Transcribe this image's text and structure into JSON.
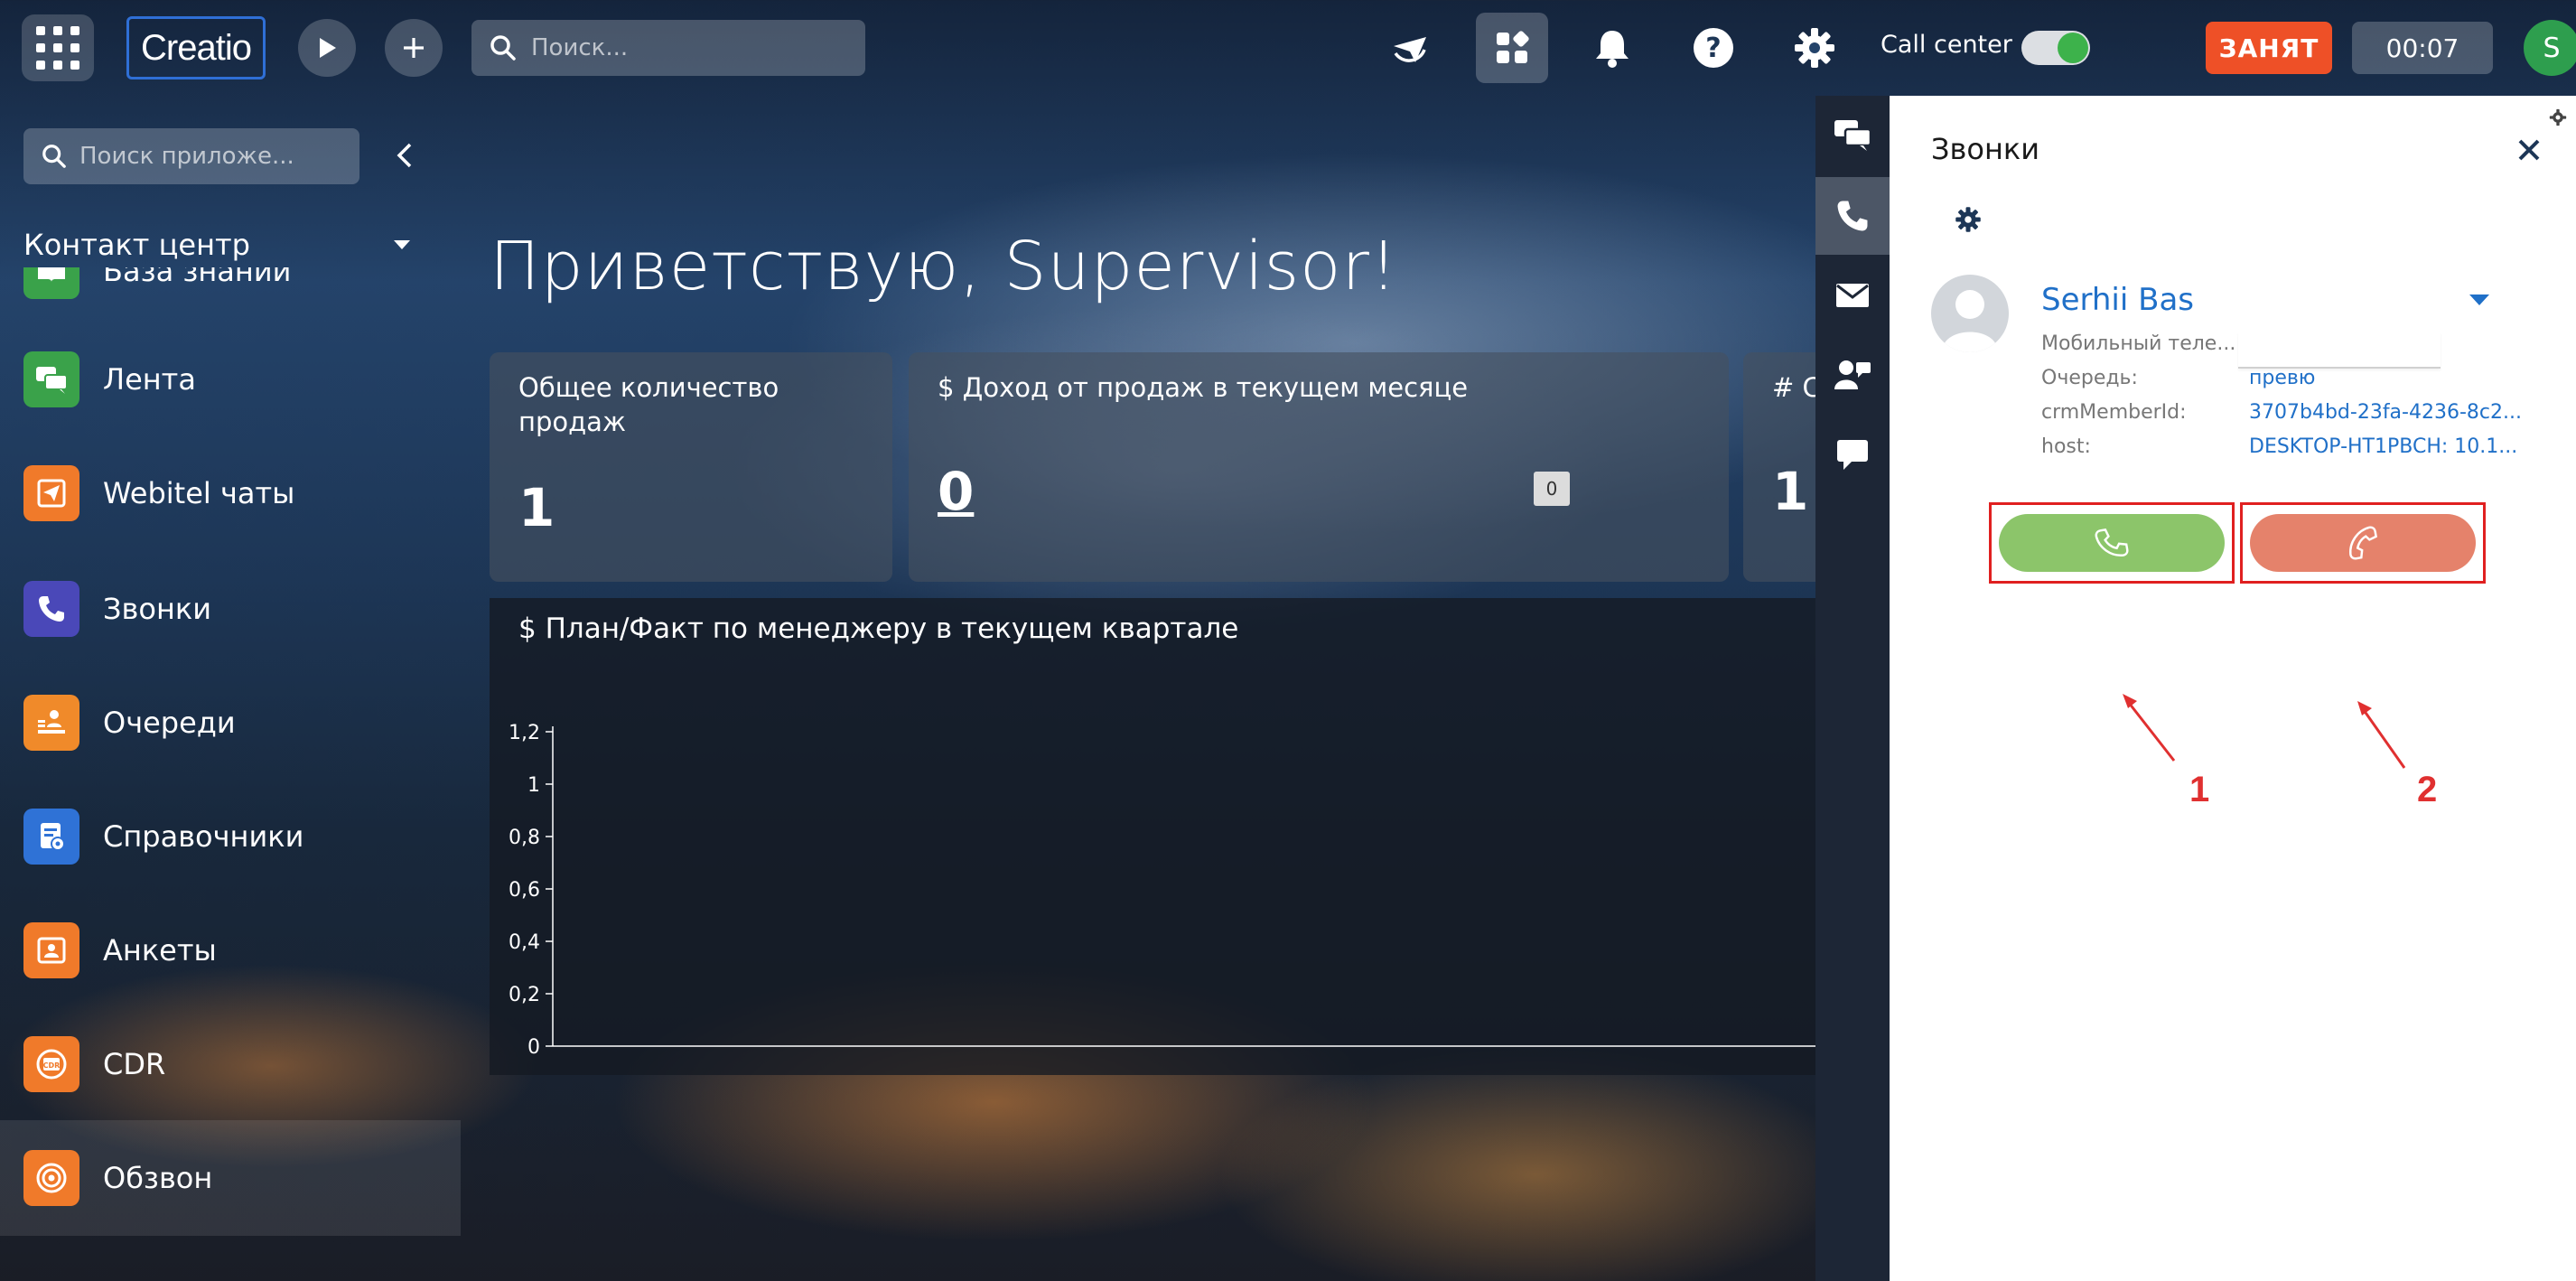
{
  "topbar": {
    "logo_text": "Creatio",
    "search_placeholder": "Поиск...",
    "call_center_label": "Call center",
    "call_center_enabled": true,
    "status_button": "ЗАНЯТ",
    "timer": "00:07",
    "user_initial": "S",
    "icons": [
      "apps-grid-icon",
      "play-icon",
      "plus-icon",
      "search-icon",
      "plane-icon",
      "tiles-icon",
      "bell-icon",
      "help-icon",
      "gear-icon"
    ]
  },
  "sidebar": {
    "search_placeholder": "Поиск приложе...",
    "section_title": "Контакт центр",
    "items": [
      {
        "label": "База знаний",
        "icon": "book-icon",
        "color": "#3aa24a"
      },
      {
        "label": "Лента",
        "icon": "chat-icon",
        "color": "#3aa24a"
      },
      {
        "label": "Webitel чаты",
        "icon": "send-icon",
        "color": "#f07a2a"
      },
      {
        "label": "Звонки",
        "icon": "phone-icon",
        "color": "#4a48b8"
      },
      {
        "label": "Очереди",
        "icon": "queue-icon",
        "color": "#f08a2a"
      },
      {
        "label": "Справочники",
        "icon": "directory-icon",
        "color": "#2f72d6"
      },
      {
        "label": "Анкеты",
        "icon": "form-icon",
        "color": "#f07a2a"
      },
      {
        "label": "CDR",
        "icon": "cdr-icon",
        "color": "#f07a2a"
      },
      {
        "label": "Обзвон",
        "icon": "dialer-icon",
        "color": "#f07a2a"
      }
    ]
  },
  "main": {
    "greeting": "Приветствую, Supervisor!",
    "cards": [
      {
        "title": "Общее количество продаж",
        "value": "1"
      },
      {
        "title": "$ Доход от продаж в текущем месяце",
        "value": "0",
        "mini": "0"
      },
      {
        "title": "# С",
        "value": "1"
      }
    ],
    "chart_title": "$ План/Факт по менеджеру в текущем квартале"
  },
  "chart_data": {
    "type": "bar",
    "title": "$ План/Факт по менеджеру в текущем квартале",
    "categories": [],
    "values": [],
    "ylim": [
      0,
      1.2
    ],
    "yticks": [
      "0",
      "0,2",
      "0,4",
      "0,6",
      "0,8",
      "1",
      "1,2"
    ]
  },
  "call_panel": {
    "title": "Звонки",
    "contact_name": "Serhii Bas",
    "fields": [
      {
        "label": "Мобильный теле...",
        "value": ""
      },
      {
        "label": "Очередь:",
        "value": "превю"
      },
      {
        "label": "crmMemberId:",
        "value": "3707b4bd-23fa-4236-8c2..."
      },
      {
        "label": "host:",
        "value": "DESKTOP-HT1PBCH: 10.1..."
      }
    ],
    "answer_color": "#8cc56a",
    "hangup_color": "#e5826b",
    "annotation_1": "1",
    "annotation_2": "2"
  },
  "right_strip": [
    "chats-icon",
    "phone-icon",
    "mail-icon",
    "agent-icon",
    "message-icon"
  ]
}
